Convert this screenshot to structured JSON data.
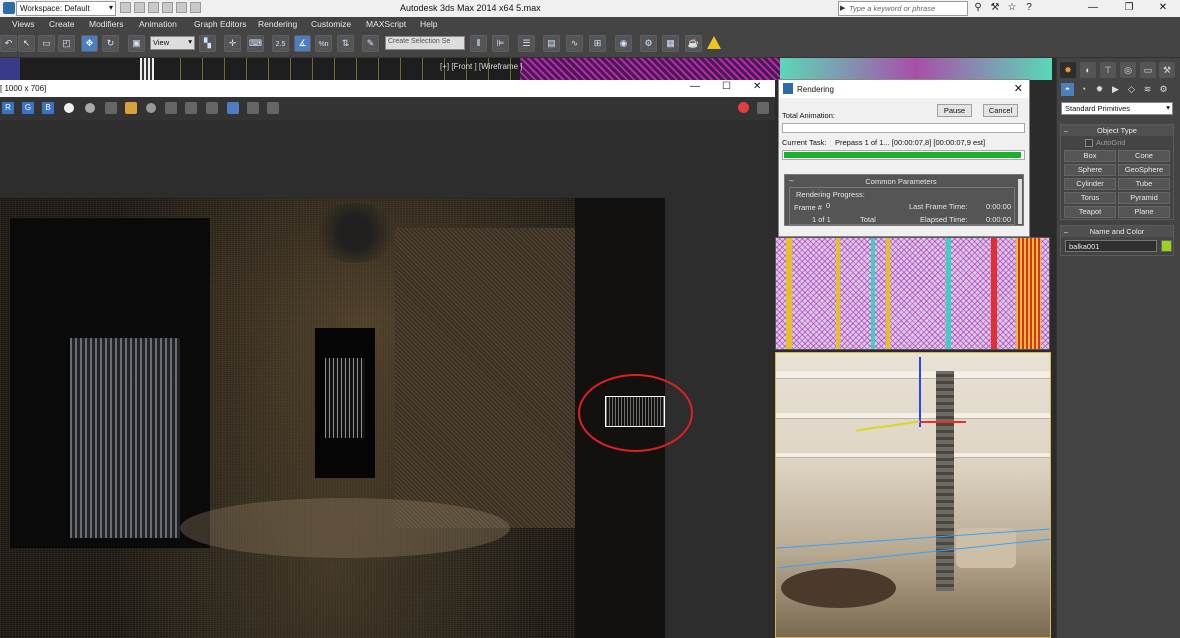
{
  "titlebar": {
    "workspace": "Workspace: Default",
    "app_title": "Autodesk 3ds Max  2014 x64     5.max",
    "search_placeholder": "Type a keyword or phrase",
    "minimize": "—",
    "maximize": "❐",
    "close": "✕"
  },
  "menu": [
    "Views",
    "Create",
    "Modifiers",
    "Animation",
    "Graph Editors",
    "Rendering",
    "Customize",
    "MAXScript",
    "Help"
  ],
  "toolbar": {
    "view_dropdown": "View",
    "selection_set_placeholder": "Create Selection Se",
    "snap_label": "2.5",
    "percent_label": "%n"
  },
  "viewport": {
    "front_label": "[+] [Front ] [Wireframe ]"
  },
  "vfb": {
    "title": "[ 1000 x 706]",
    "channels": [
      "R",
      "G",
      "B"
    ],
    "minimize": "—",
    "maximize": "☐",
    "close": "✕"
  },
  "render_dialog": {
    "title": "Rendering",
    "pause": "Pause",
    "cancel": "Cancel",
    "total_animation": "Total Animation:",
    "total_progress": 0.0,
    "current_task_label": "Current Task:",
    "current_task_value": "Prepass 1 of 1... [00:00:07,8] [00:00:07,9 est]",
    "current_progress": 0.99,
    "common_parameters": "Common Parameters",
    "rendering_progress": "Rendering Progress:",
    "frame_label": "Frame #",
    "frame_value": "0",
    "of_label": "1 of 1",
    "total_label": "Total",
    "last_frame_time_label": "Last Frame Time:",
    "last_frame_time": "0:00:00",
    "elapsed_time_label": "Elapsed Time:",
    "elapsed_time": "0:00:00"
  },
  "command_panel": {
    "primitive_dropdown": "Standard Primitives",
    "object_type": "Object Type",
    "autogrid": "AutoGrid",
    "buttons": [
      "Box",
      "Cone",
      "Sphere",
      "GeoSphere",
      "Cylinder",
      "Tube",
      "Torus",
      "Pyramid",
      "Teapot",
      "Plane"
    ],
    "name_and_color": "Name and Color",
    "object_name": "balka001",
    "object_color": "#9bd21a"
  },
  "colors": {
    "annotation": "#e02020",
    "progress": "#1bb02a",
    "accent": "#4d7ebf"
  }
}
